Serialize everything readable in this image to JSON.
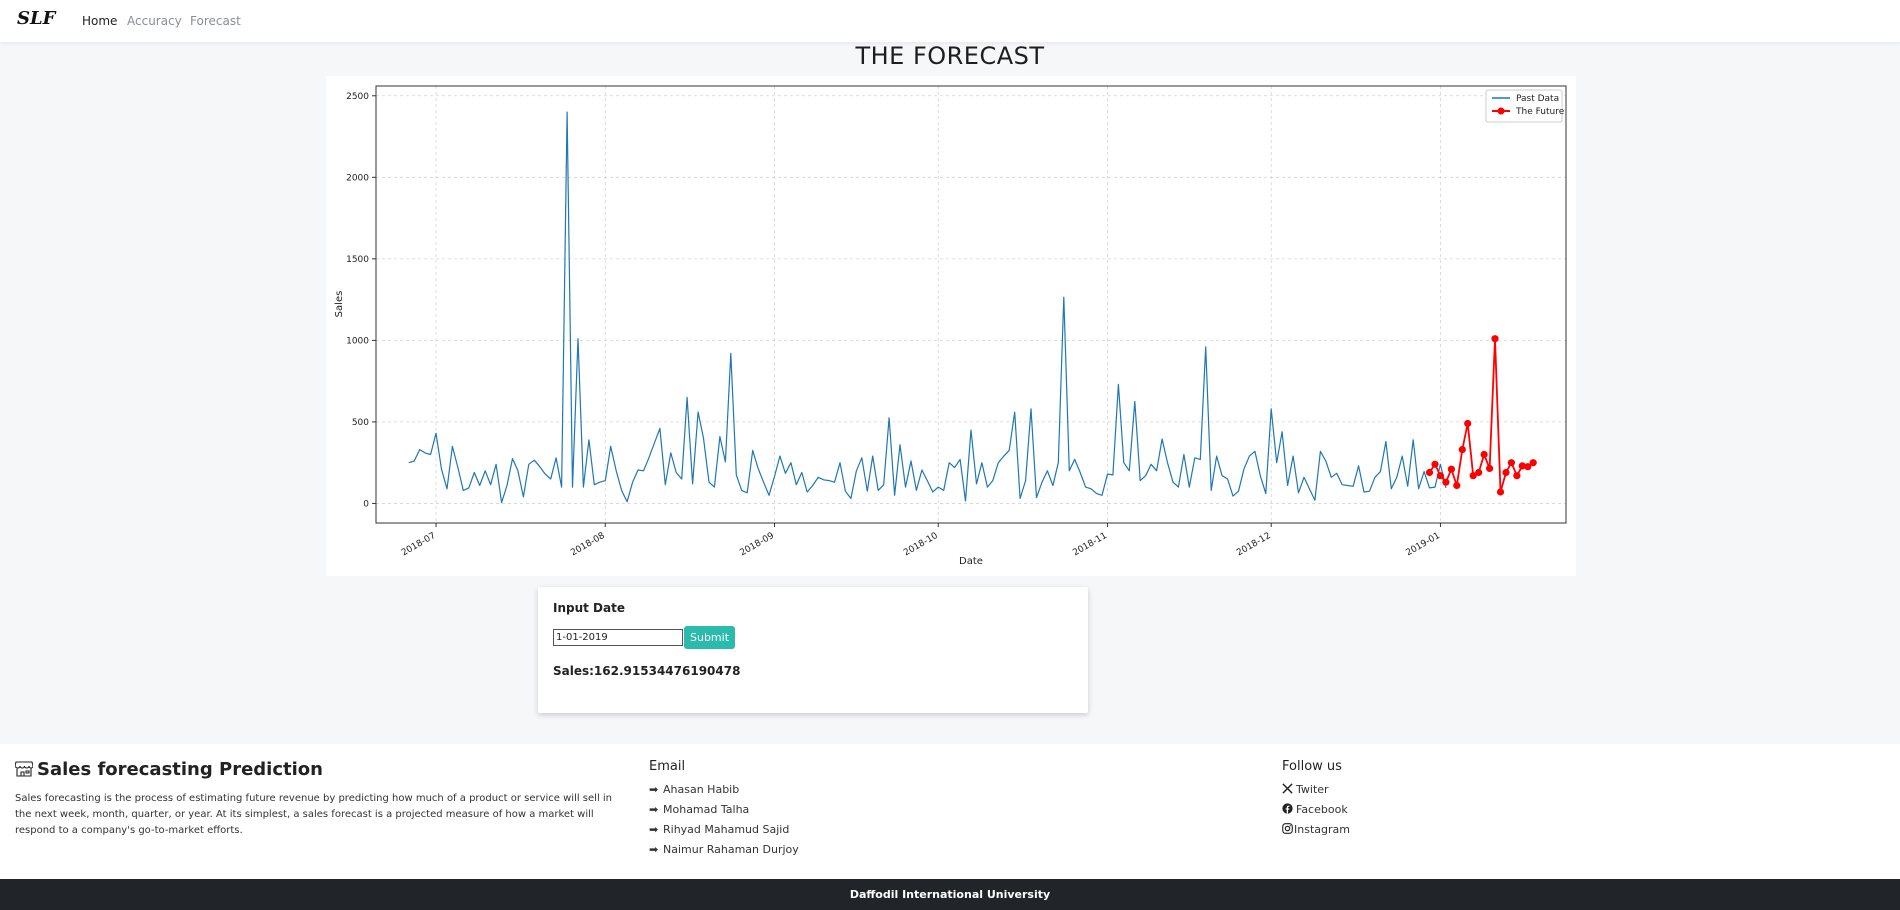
{
  "nav": {
    "brand": "SLF",
    "links": [
      "Home",
      "Accuracy",
      "Forecast"
    ]
  },
  "page": {
    "title": "THE FORECAST"
  },
  "chart_data": {
    "type": "line",
    "xlabel": "Date",
    "ylabel": "Sales",
    "ylim": [
      -120,
      2560
    ],
    "xlim": [
      "2018-06-20",
      "2019-01-24"
    ],
    "y_ticks": [
      0,
      500,
      1000,
      1500,
      2000,
      2500
    ],
    "x_ticks": [
      "2018-07",
      "2018-08",
      "2018-09",
      "2018-10",
      "2018-11",
      "2018-12",
      "2019-01"
    ],
    "x_tick_dates": [
      "2018-07-01",
      "2018-08-01",
      "2018-09-01",
      "2018-10-01",
      "2018-11-01",
      "2018-12-01",
      "2019-01-01"
    ],
    "grid": true,
    "legend_position": "top-right",
    "series": [
      {
        "name": "Past Data",
        "color": "#1f77b4",
        "marker": "none",
        "x_start": "2018-06-26",
        "x_step_days": 1,
        "values": [
          250,
          260,
          330,
          310,
          300,
          430,
          210,
          90,
          350,
          220,
          80,
          95,
          190,
          110,
          200,
          115,
          240,
          5,
          110,
          275,
          200,
          40,
          240,
          265,
          225,
          180,
          150,
          280,
          100,
          2400,
          100,
          1010,
          100,
          390,
          115,
          130,
          140,
          350,
          200,
          80,
          10,
          130,
          205,
          200,
          280,
          370,
          460,
          115,
          310,
          190,
          150,
          650,
          120,
          560,
          400,
          130,
          100,
          410,
          255,
          920,
          175,
          80,
          65,
          325,
          215,
          130,
          50,
          165,
          290,
          185,
          250,
          115,
          190,
          70,
          110,
          160,
          145,
          140,
          130,
          250,
          75,
          30,
          200,
          280,
          75,
          290,
          80,
          115,
          525,
          50,
          360,
          100,
          260,
          80,
          205,
          140,
          70,
          100,
          80,
          250,
          220,
          270,
          15,
          450,
          120,
          250,
          100,
          140,
          250,
          290,
          325,
          560,
          30,
          140,
          580,
          35,
          130,
          200,
          110,
          250,
          1265,
          200,
          270,
          190,
          100,
          90,
          60,
          50,
          180,
          175,
          730,
          250,
          200,
          625,
          140,
          170,
          240,
          200,
          395,
          250,
          130,
          100,
          300,
          100,
          280,
          270,
          960,
          80,
          290,
          170,
          150,
          45,
          75,
          210,
          290,
          320,
          170,
          60,
          580,
          250,
          440,
          110,
          290,
          65,
          160,
          90,
          20,
          320,
          260,
          160,
          185,
          115,
          110,
          105,
          230,
          70,
          75,
          160,
          195,
          380,
          90,
          160,
          290,
          105,
          390,
          90,
          195,
          95,
          100,
          240,
          95
        ]
      },
      {
        "name": "The Future",
        "color": "#ff0000",
        "marker": "circle",
        "x_start": "2018-12-30",
        "x_step_days": 1,
        "values": [
          190,
          240,
          170,
          130,
          210,
          110,
          330,
          490,
          170,
          190,
          300,
          215,
          1010,
          70,
          190,
          250,
          170,
          230,
          225,
          250
        ]
      }
    ]
  },
  "form": {
    "label": "Input Date",
    "date_value": "1-01-2019",
    "submit_label": "Submit",
    "result": "Sales:162.91534476190478"
  },
  "footer": {
    "title": "Sales forecasting Prediction",
    "description": "Sales forecasting is the process of estimating future revenue by predicting how much of a product or service will sell in the next week, month, quarter, or year. At its simplest, a sales forecast is a projected measure of how a market will respond to a company's go-to-market efforts.",
    "email_heading": "Email",
    "emails": [
      "Ahasan Habib",
      "Mohamad Talha",
      "Rihyad Mahamud Sajid",
      "Naimur Rahaman Durjoy"
    ],
    "follow_heading": "Follow us",
    "social": [
      "Twiter",
      "Facebook",
      "Instagram"
    ],
    "social_icons": [
      "x-icon",
      "facebook-icon",
      "instagram-icon"
    ]
  },
  "bottom": {
    "text": "Daffodil International University"
  }
}
